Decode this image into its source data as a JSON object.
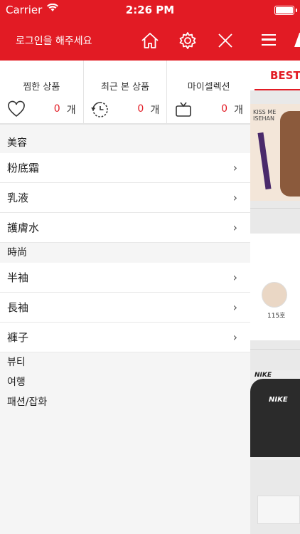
{
  "status_bar": {
    "carrier": "Carrier",
    "time": "2:26 PM"
  },
  "header": {
    "login_text": "로그인을 해주세요"
  },
  "stats": [
    {
      "title": "찜한 상품",
      "count": "0",
      "unit": "개",
      "icon": "heart-icon"
    },
    {
      "title": "최근 본 상품",
      "count": "0",
      "unit": "개",
      "icon": "history-icon"
    },
    {
      "title": "마이셀렉션",
      "count": "0",
      "unit": "개",
      "icon": "tv-icon"
    }
  ],
  "menu": {
    "cat1": {
      "label": "美容",
      "items": [
        "粉底霜",
        "乳液",
        "護膚水"
      ]
    },
    "cat2": {
      "label": "時尚",
      "items": [
        "半袖",
        "長袖",
        "褲子"
      ]
    },
    "plain": [
      "뷰티",
      "여행",
      "패션/잡화"
    ]
  },
  "background": {
    "tab_label": "BEST",
    "product1_brand": "KISS ME",
    "product1_sub": "ISEHAN",
    "swatch_label": "115호",
    "product2_brand": "NIKE",
    "product2_logo": "NIKE"
  },
  "colors": {
    "accent": "#e21b24"
  },
  "chevron": "›"
}
